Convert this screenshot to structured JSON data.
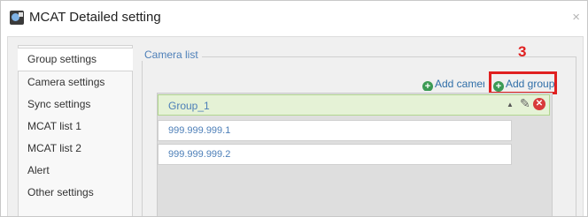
{
  "window": {
    "title": "MCAT Detailed setting",
    "close_glyph": "×"
  },
  "sidebar": {
    "items": [
      {
        "label": "Group settings",
        "active": true
      },
      {
        "label": "Camera settings"
      },
      {
        "label": "Sync settings"
      },
      {
        "label": "MCAT list 1"
      },
      {
        "label": "MCAT list 2"
      },
      {
        "label": "Alert"
      },
      {
        "label": "Other settings"
      }
    ]
  },
  "camera_list": {
    "legend": "Camera list",
    "step_number": "3",
    "add_camera_label": "Add camera",
    "add_group_label": "Add group",
    "group": {
      "name": "Group_1"
    },
    "cameras": [
      "999.999.999.1",
      "999.999.999.2"
    ]
  },
  "icons": {
    "app": "app-icon",
    "close": "close-icon",
    "plus": "plus-circle-icon",
    "caret": "caret-up-icon",
    "edit": "pencil-icon",
    "delete": "delete-circle-icon"
  },
  "colors": {
    "accent_text": "#4d7fb8",
    "link": "#2f6ea8",
    "plus_green": "#3c9a54",
    "highlight_red": "#e02020",
    "group_row_bg": "#e5f2d6",
    "delete_red": "#d83a3a"
  }
}
